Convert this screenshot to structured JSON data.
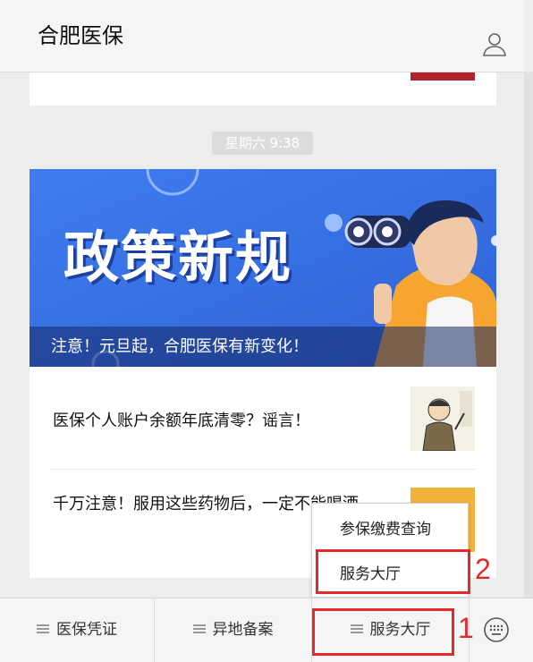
{
  "window": {
    "controls": [
      "pin-icon",
      "minimize-icon",
      "maximize-icon",
      "close-icon"
    ]
  },
  "header": {
    "title": "合肥医保",
    "profile_icon": "user-icon"
  },
  "chat": {
    "timestamp": "星期六  9:38"
  },
  "article": {
    "banner_headline": "政策新规",
    "banner_caption": "注意！元旦起，合肥医保有新变化！",
    "items": [
      {
        "title": "医保个人账户余额年底清零？谣言！"
      },
      {
        "title": "千万注意！服用这些药物后，一定不能喝酒"
      }
    ]
  },
  "popup_menu": {
    "items": [
      {
        "label": "参保缴费查询"
      },
      {
        "label": "服务大厅"
      }
    ]
  },
  "bottom_menu": {
    "items": [
      {
        "label": "医保凭证"
      },
      {
        "label": "异地备案"
      },
      {
        "label": "服务大厅"
      }
    ],
    "keyboard_icon": "keyboard-icon"
  },
  "annotations": {
    "marker_1": "1",
    "marker_2": "2",
    "color": "#e12a2a"
  },
  "colors": {
    "banner_blue": "#3b73e8",
    "accent_red": "#e12a2a"
  }
}
